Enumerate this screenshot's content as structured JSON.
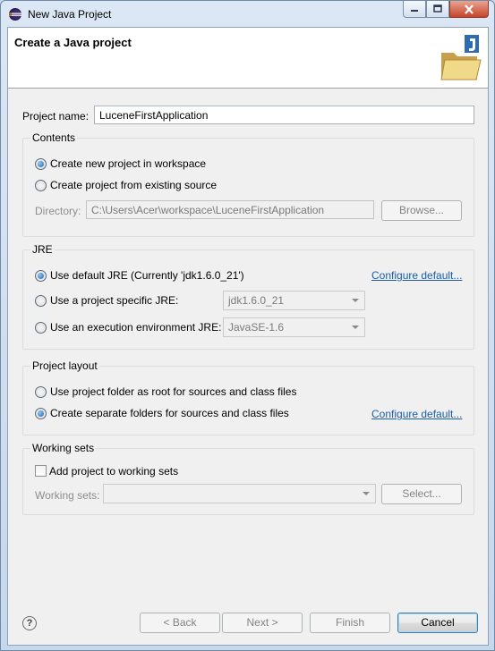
{
  "window": {
    "title": "New Java Project"
  },
  "banner": {
    "title": "Create a Java project",
    "icon": "java-project-folder-icon"
  },
  "project_name": {
    "label": "Project name:",
    "value": "LuceneFirstApplication"
  },
  "contents": {
    "title": "Contents",
    "option_new": "Create new project in workspace",
    "option_existing": "Create project from existing source",
    "directory_label": "Directory:",
    "directory_value": "C:\\Users\\Acer\\workspace\\LuceneFirstApplication",
    "browse_label": "Browse...",
    "selected": "new"
  },
  "jre": {
    "title": "JRE",
    "option_default": "Use default JRE (Currently 'jdk1.6.0_21')",
    "configure_link": "Configure default...",
    "option_specific": "Use a project specific JRE:",
    "specific_value": "jdk1.6.0_21",
    "option_env": "Use an execution environment JRE:",
    "env_value": "JavaSE-1.6",
    "selected": "default"
  },
  "layout": {
    "title": "Project layout",
    "option_root": "Use project folder as root for sources and class files",
    "option_separate": "Create separate folders for sources and class files",
    "configure_link": "Configure default...",
    "selected": "separate"
  },
  "working_sets": {
    "title": "Working sets",
    "add_label": "Add project to working sets",
    "add_checked": false,
    "sets_label": "Working sets:",
    "sets_value": "",
    "select_label": "Select..."
  },
  "footer": {
    "back_label": "< Back",
    "next_label": "Next >",
    "finish_label": "Finish",
    "cancel_label": "Cancel"
  }
}
